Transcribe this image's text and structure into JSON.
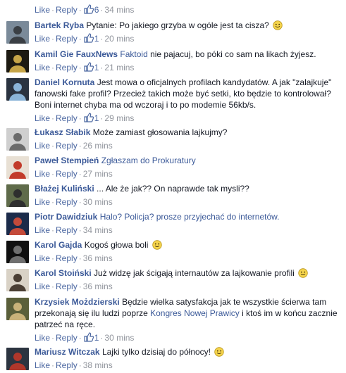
{
  "actions": {
    "like": "Like",
    "reply": "Reply",
    "sep": "·"
  },
  "top_meta": {
    "likes": "6",
    "time": "34 mins"
  },
  "comments": [
    {
      "author": "Bartek Ryba",
      "parts": [
        {
          "t": "Pytanie: Po jakiego grzyba w ogóle jest ta cisza?"
        }
      ],
      "emoji": true,
      "likes": "1",
      "time": "20 mins"
    },
    {
      "author": "Kamil Gie FauxNews",
      "parts": [
        {
          "t": "Faktoid",
          "link": true
        },
        {
          "t": " nie pajacuj, bo póki co sam na likach żyjesz."
        }
      ],
      "likes": "1",
      "time": "21 mins"
    },
    {
      "author": "Daniel Kornuta",
      "parts": [
        {
          "t": "Jest mowa o oficjalnych profilach kandydatów. A jak \"zalajkuje\" fanowski fake profil? Przecież takich może być setki, kto będzie to kontrolował? Boni internet chyba ma od wczoraj i to po modemie 56kb/s."
        }
      ],
      "likes": "1",
      "time": "29 mins"
    },
    {
      "author": "Łukasz Słabik",
      "parts": [
        {
          "t": "Może zamiast głosowania lajkujmy?"
        }
      ],
      "time": "26 mins"
    },
    {
      "author": "Paweł Stempień",
      "parts": [
        {
          "t": "Zgłaszam do Prokuratury",
          "link": true
        }
      ],
      "time": "27 mins"
    },
    {
      "author": "Błażej Kuliński",
      "parts": [
        {
          "t": "... Ale że jak?? On naprawde tak mysli??"
        }
      ],
      "time": "30 mins"
    },
    {
      "author": "Piotr Dawidziuk",
      "parts": [
        {
          "t": "Halo? Policja? prosze przyjechać do internetów.",
          "link": true
        }
      ],
      "time": "34 mins"
    },
    {
      "author": "Karol Gajda",
      "parts": [
        {
          "t": "Kogoś głowa boli"
        }
      ],
      "emoji": true,
      "time": "36 mins"
    },
    {
      "author": "Karol Stoiński",
      "parts": [
        {
          "t": "Już widzę jak ścigają internautów za lajkowanie profili"
        }
      ],
      "emoji": true,
      "time": "36 mins"
    },
    {
      "author": "Krzysiek Możdzierski",
      "parts": [
        {
          "t": "Będzie wielka satysfakcja jak te wszystkie ścierwa tam przekonają się ilu ludzi poprze "
        },
        {
          "t": "Kongres Nowej Prawicy",
          "link": true
        },
        {
          "t": " i ktoś im w końcu zacznie patrzeć na ręce."
        }
      ],
      "likes": "1",
      "time": "30 mins"
    },
    {
      "author": "Mariusz Witczak",
      "parts": [
        {
          "t": "Lajki tylko dzisiaj do północy!"
        }
      ],
      "emoji": true,
      "time": "38 mins"
    }
  ],
  "colors": {
    "name": "#3b5998",
    "meta": "#90949c",
    "action": "#4b67a1",
    "text": "#141823"
  }
}
